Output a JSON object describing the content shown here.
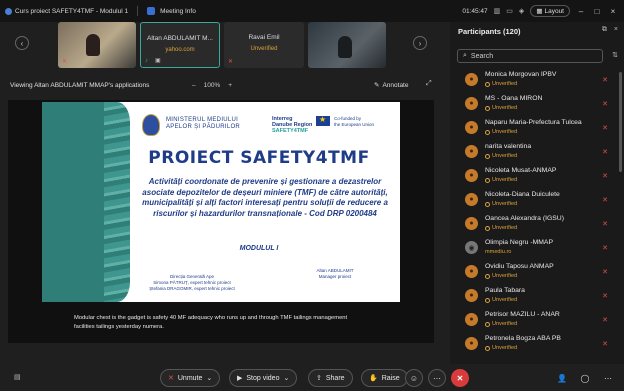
{
  "window": {
    "title": "Curs proiect SAFETY4TMF - Modulul 1",
    "meeting_info": "Meeting Info",
    "time": "01:45:47",
    "layout_label": "Layout"
  },
  "videos": [
    {
      "name": "",
      "status": ""
    },
    {
      "name": "Altan ABDULAMIT M...",
      "status": "yahoo.com"
    },
    {
      "name": "Ravai Emil",
      "status": "Unverified"
    },
    {
      "name": "",
      "status": ""
    }
  ],
  "share": {
    "viewing_label": "Viewing Altan ABDULAMIT MMAP's applications",
    "zoom": "100%",
    "annotate_label": "Annotate"
  },
  "slide": {
    "ministry_line1": "MINISTERUL MEDIULUI",
    "ministry_line2": "APELOR ȘI PĂDURILOR",
    "interreg_line1": "Interreg",
    "interreg_line2": "Danube Region",
    "safety_tag": "SAFETY4TMF",
    "eu_text1": "Co-funded by",
    "eu_text2": "the European Union",
    "title": "PROIECT SAFETY4TMF",
    "subtitle": "Activități coordonate de prevenire și gestionare a dezastrelor asociate depozitelor de deșeuri miniere (TMF) de către autorități, municipalități și alți factori interesați pentru soluții de reducere a riscurilor și hazardurilor transnaționale - Cod  DRP 0200484",
    "modul": "MODULUL I",
    "people_left_line1": "Direcția Generală Ape",
    "people_left_line2": "Simona PĂTRUȚ, expert tehnic proiect",
    "people_left_line3": "Ștefania DRAGOMIR, expert tehnic proiect",
    "people_right_line1": "Altan ABDULAMIT",
    "people_right_line2": "Manager proiect"
  },
  "caption": "Modular chest is the gadget is safety 40 MF adequacy who runs up and through TMF tailings management facilities tailings yesterday numera.",
  "controls": {
    "unmute": "Unmute",
    "stop_video": "Stop video",
    "share": "Share",
    "raise": "Raise"
  },
  "participants": {
    "header": "Participants (120)",
    "search_placeholder": "Search",
    "list": [
      {
        "name": "Monica Morgovan IPBV",
        "status": "Unverified"
      },
      {
        "name": "MS - Oana MIRON",
        "status": "Unverified"
      },
      {
        "name": "Naparu Maria-Prefectura Tulcea",
        "status": "Unverified"
      },
      {
        "name": "narita valentina",
        "status": "Unverified"
      },
      {
        "name": "Nicoleta Musat-ANMAP",
        "status": "Unverified"
      },
      {
        "name": "Nicoleta-Diana Duiculete",
        "status": "Unverified"
      },
      {
        "name": "Oancea Alexandra (IGSU)",
        "status": "Unverified"
      },
      {
        "name": "Olimpia Negru -MMAP",
        "status": "mmediu.ro"
      },
      {
        "name": "Ovidiu Taposu ANMAP",
        "status": "Unverified"
      },
      {
        "name": "Paula Tabara",
        "status": "Unverified"
      },
      {
        "name": "Petrisor MAZILU - ANAR",
        "status": "Unverified"
      },
      {
        "name": "Petronela Bogza ABA PB",
        "status": "Unverified"
      }
    ]
  },
  "colors": {
    "accent_teal": "#3aa89b",
    "unverified": "#d9a23b",
    "end_call": "#d83b3b",
    "slide_blue": "#1f3c88"
  }
}
